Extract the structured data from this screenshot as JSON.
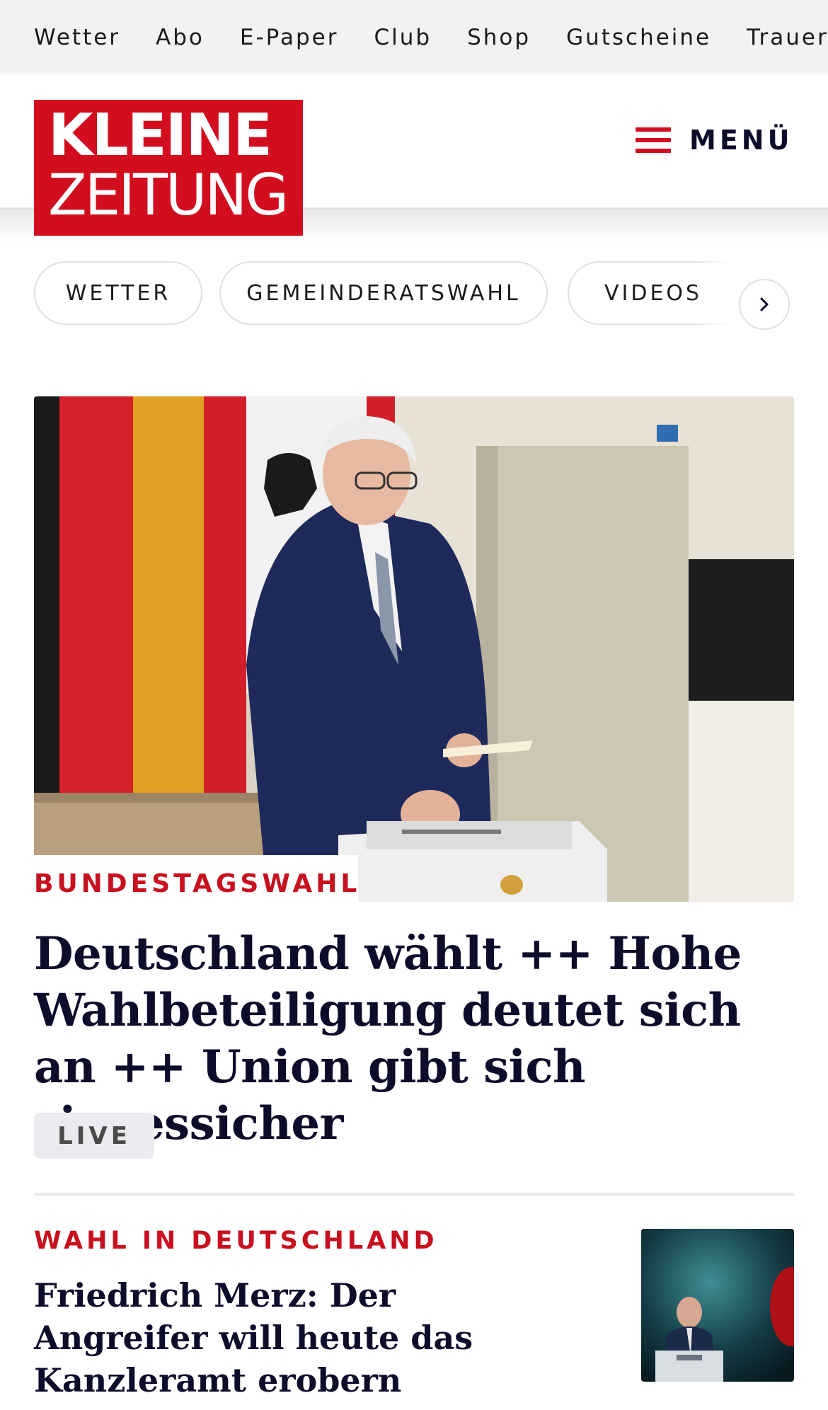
{
  "topnav": {
    "items": [
      "Wetter",
      "Abo",
      "E-Paper",
      "Club",
      "Shop",
      "Gutscheine",
      "Trauerportal"
    ]
  },
  "header": {
    "logo_line1": "KLEINE",
    "logo_line2": "ZEITUNG",
    "menu_label": "MENÜ",
    "brand_color": "#d20e1e"
  },
  "chips": {
    "items": [
      "WETTER",
      "GEMEINDERATSWAHL",
      "VIDEOS"
    ],
    "next_icon": "chevron-right-icon"
  },
  "hero": {
    "tag": "BUNDESTAGSWAHL",
    "title": "Deutschland wählt ++ Hohe Wahlbeteiligung deutet sich an ++ Union gibt sich siegessicher",
    "badge": "LIVE"
  },
  "article2": {
    "tag": "WAHL IN DEUTSCHLAND",
    "title": "Friedrich Merz: Der Angreifer will heute das Kanzleramt erobern"
  },
  "colors": {
    "accent_red": "#c8101e",
    "headline": "#0d0d2b",
    "topnav_bg": "#f2f2f2"
  }
}
